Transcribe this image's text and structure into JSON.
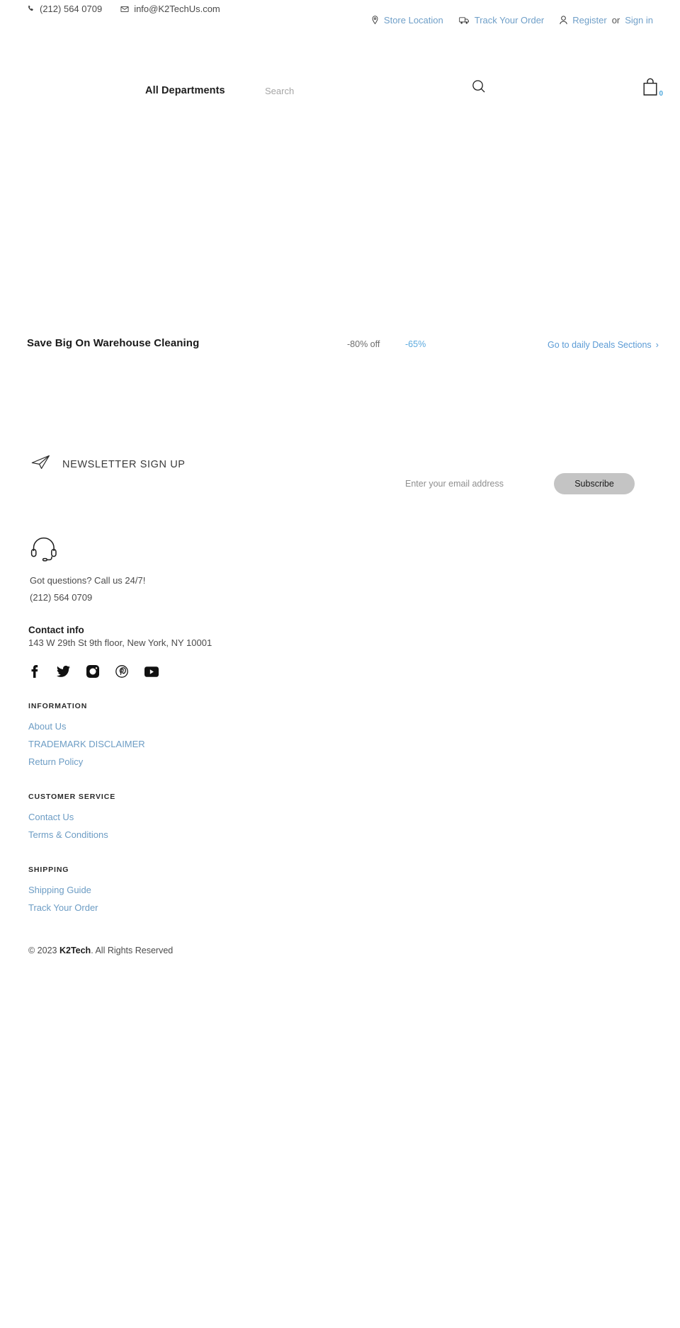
{
  "topbar": {
    "phone": "(212) 564 0709",
    "email": "info@K2TechUs.com",
    "phone_icon": "phone-icon",
    "email_icon": "envelope-icon",
    "store_location": "Store Location",
    "track_order": "Track Your Order",
    "register": "Register",
    "or": "or",
    "sign_in": "Sign in",
    "location_icon": "map-pin-icon",
    "truck_icon": "delivery-truck-icon",
    "user_icon": "user-icon"
  },
  "header": {
    "all_departments": "All Departments",
    "search_placeholder": "Search",
    "search_value": "",
    "search_icon": "search-icon",
    "cart_icon": "shopping-bag-icon",
    "cart_count": "0"
  },
  "deals": {
    "title": "Save Big On Warehouse Cleaning",
    "discount_label": "-80% off",
    "discount_value": "-65%",
    "link": "Go to daily Deals Sections",
    "chevron": "›"
  },
  "newsletter": {
    "icon": "paper-plane-icon",
    "title": "NEWSLETTER SIGN UP",
    "email_placeholder": "Enter your email address",
    "email_value": "",
    "button": "Subscribe"
  },
  "footer": {
    "support_icon": "headset-icon",
    "support_line1": "Got questions? Call us 24/7!",
    "support_phone": "(212) 564 0709",
    "contact_title": "Contact info",
    "contact_address": "143 W 29th St 9th floor, New York, NY 10001",
    "social": [
      {
        "name": "facebook-icon",
        "label": "Facebook"
      },
      {
        "name": "twitter-icon",
        "label": "Twitter"
      },
      {
        "name": "instagram-icon",
        "label": "Instagram"
      },
      {
        "name": "pinterest-icon",
        "label": "Pinterest"
      },
      {
        "name": "youtube-icon",
        "label": "YouTube"
      }
    ],
    "columns": [
      {
        "title": "INFORMATION",
        "links": [
          "About Us",
          "TRADEMARK DISCLAIMER",
          "Return Policy"
        ]
      },
      {
        "title": "CUSTOMER SERVICE",
        "links": [
          "Contact Us",
          "Terms & Conditions"
        ]
      },
      {
        "title": "SHIPPING",
        "links": [
          "Shipping Guide",
          "Track Your Order"
        ]
      }
    ],
    "copyright_prefix": "© 2023 ",
    "copyright_brand": "K2Tech",
    "copyright_suffix": ". All Rights Reserved"
  },
  "colors": {
    "link_blue": "#6c9cc4",
    "accent_blue": "#5b9bd5",
    "text_dark": "#1d1d1d",
    "text_muted": "#4b4b4b",
    "button_grey": "#c4c4c4"
  }
}
